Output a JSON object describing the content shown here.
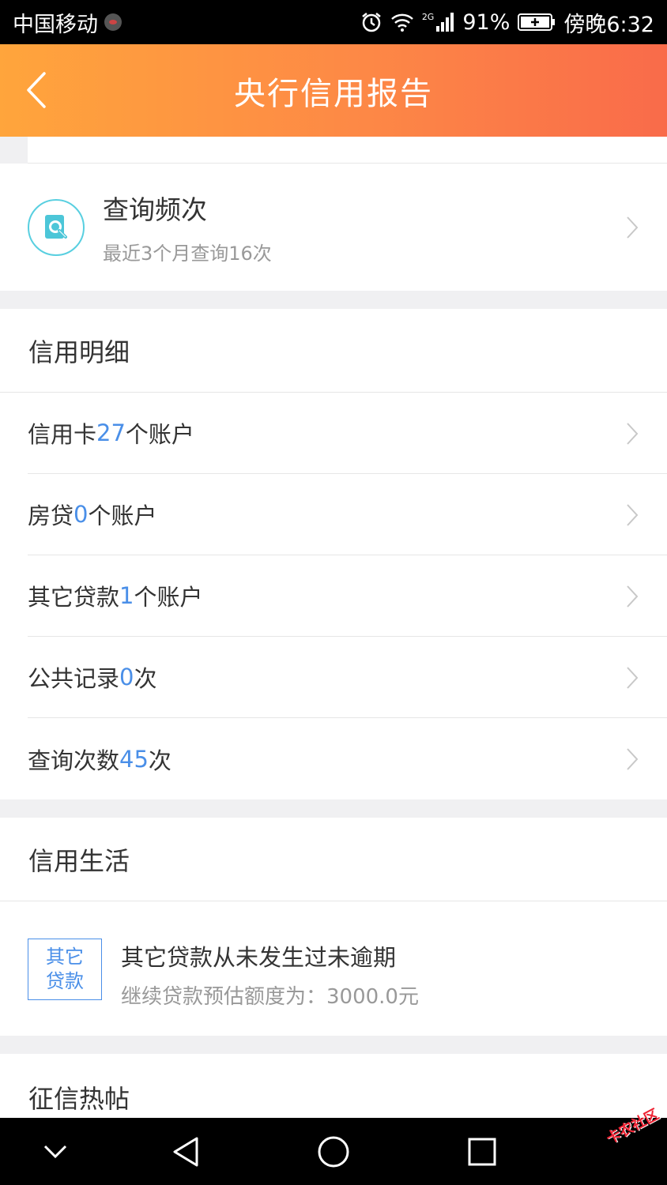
{
  "status_bar": {
    "carrier": "中国移动",
    "network": "2G",
    "battery": "91%",
    "time": "傍晚6:32"
  },
  "header": {
    "title": "央行信用报告",
    "back_icon": "chevron-left-icon"
  },
  "query_frequency": {
    "title": "查询频次",
    "subtitle": "最近3个月查询16次",
    "icon": "search-document-icon",
    "icon_color": "#58cfe0"
  },
  "credit_detail": {
    "title": "信用明细",
    "rows": [
      {
        "prefix": "信用卡",
        "value": "27",
        "suffix": "个账户"
      },
      {
        "prefix": "房贷",
        "value": "0",
        "suffix": "个账户"
      },
      {
        "prefix": "其它贷款",
        "value": "1",
        "suffix": "个账户"
      },
      {
        "prefix": "公共记录",
        "value": "0",
        "suffix": "次"
      },
      {
        "prefix": "查询次数",
        "value": "45",
        "suffix": "次"
      }
    ]
  },
  "credit_life": {
    "title": "信用生活",
    "tag_line1": "其它",
    "tag_line2": "贷款",
    "headline": "其它贷款从未发生过未逾期",
    "detail": "继续贷款预估额度为：3000.0元"
  },
  "hot_posts": {
    "title": "征信热帖"
  },
  "watermark": "卡农社区",
  "colors": {
    "accent": "#4a8fe8",
    "header_start": "#ffa53c",
    "header_end": "#f96b4a"
  }
}
